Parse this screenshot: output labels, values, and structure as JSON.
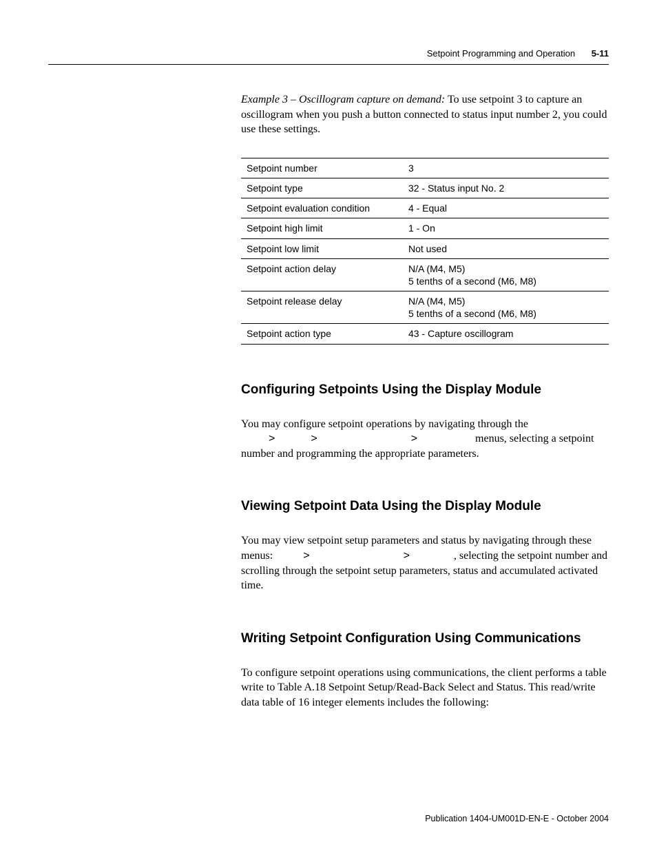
{
  "header": {
    "title": "Setpoint Programming and Operation",
    "page": "5-11"
  },
  "example": {
    "lead": "Example 3 – Oscillogram capture on demand:",
    "text": " To use setpoint 3 to capture an oscillogram when you push a button connected to status input number 2, you could use these settings."
  },
  "table": {
    "rows": [
      {
        "label": "Setpoint number",
        "value": "3"
      },
      {
        "label": "Setpoint type",
        "value": "32 - Status input No. 2"
      },
      {
        "label": "Setpoint evaluation condition",
        "value": "4 - Equal"
      },
      {
        "label": "Setpoint high limit",
        "value": "1 - On"
      },
      {
        "label": "Setpoint low limit",
        "value": "Not used"
      },
      {
        "label": "Setpoint action delay",
        "value": "N/A (M4, M5)\n5 tenths of a second (M6, M8)"
      },
      {
        "label": "Setpoint release delay",
        "value": "N/A (M4, M5)\n5 tenths of a second (M6, M8)"
      },
      {
        "label": "Setpoint action type",
        "value": "43 - Capture oscillogram"
      }
    ]
  },
  "sections": {
    "configuring": {
      "heading": "Configuring Setpoints Using the Display Module",
      "p1a": "You may configure setpoint operations by navigating through the ",
      "sep": ">",
      "p1b": " menus, selecting a setpoint number and programming the appropriate parameters."
    },
    "viewing": {
      "heading": "Viewing Setpoint Data Using the Display Module",
      "p1a": "You may view setpoint setup parameters and status by navigating through these menus: ",
      "sep": ">",
      "p1b": ", selecting the setpoint number and scrolling through the setpoint setup parameters, status and accumulated activated time."
    },
    "writing": {
      "heading": "Writing Setpoint Configuration Using Communications",
      "p1": "To configure setpoint operations using communications, the client performs a table write to Table A.18 Setpoint Setup/Read-Back Select and Status. This read/write data table of 16 integer elements includes the following:"
    }
  },
  "footer": {
    "text": "Publication 1404-UM001D-EN-E - October 2004"
  }
}
